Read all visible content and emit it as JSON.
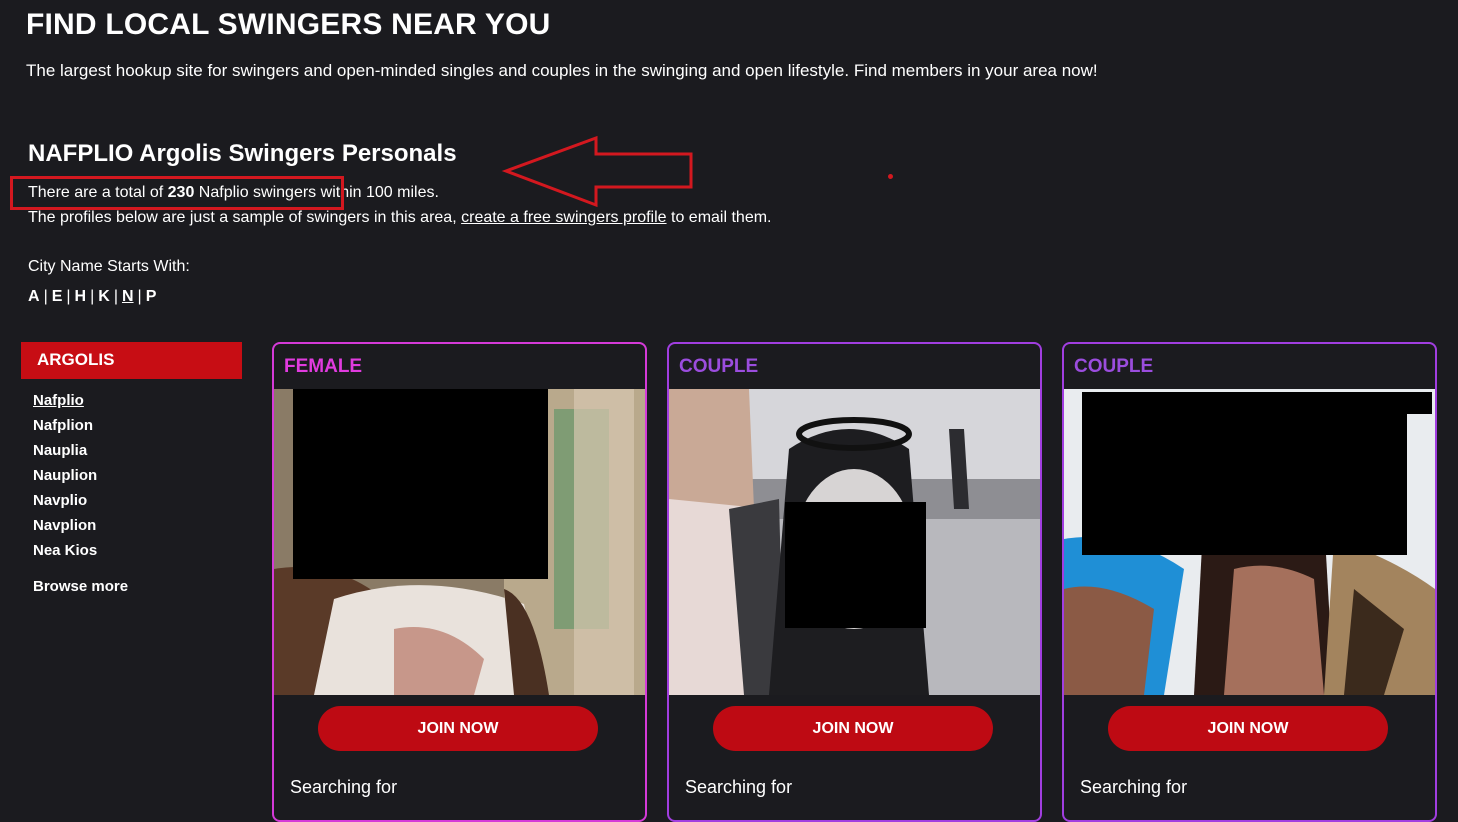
{
  "header": {
    "title": "FIND LOCAL SWINGERS NEAR YOU",
    "tagline": "The largest hookup site for swingers and open-minded singles and couples in the swinging and open lifestyle. Find members in your area now!"
  },
  "section": {
    "title": "NAFPLIO Argolis Swingers Personals",
    "total_prefix": "There are a total of",
    "total_count": "230",
    "total_suffix_highlighted": "Nafplio swingers",
    "total_suffix_rest": "within 100 miles.",
    "sample_prefix": "The profiles below are just a sample of swingers in this area,",
    "sample_link": "create a free swingers profile",
    "sample_suffix": "to email them."
  },
  "city_filter": {
    "label": "City Name Starts With:",
    "letters": [
      "A",
      "E",
      "H",
      "K",
      "N",
      "P"
    ],
    "active_letter": "N"
  },
  "sidebar": {
    "region": "ARGOLIS",
    "cities": [
      "Nafplio",
      "Nafplion",
      "Nauplia",
      "Nauplion",
      "Navplio",
      "Navplion",
      "Nea Kios"
    ],
    "active_city": "Nafplio",
    "browse_more": "Browse more"
  },
  "cards": [
    {
      "type": "FEMALE",
      "button": "JOIN NOW",
      "searching": "Searching for"
    },
    {
      "type": "COUPLE",
      "button": "JOIN NOW",
      "searching": "Searching for"
    },
    {
      "type": "COUPLE",
      "button": "JOIN NOW",
      "searching": "Searching for"
    }
  ],
  "colors": {
    "background": "#1b1b1f",
    "accent_red": "#c70d14",
    "female_label": "#e13bdf",
    "couple_label": "#9b4dde",
    "annotation_red": "#d3181f"
  }
}
